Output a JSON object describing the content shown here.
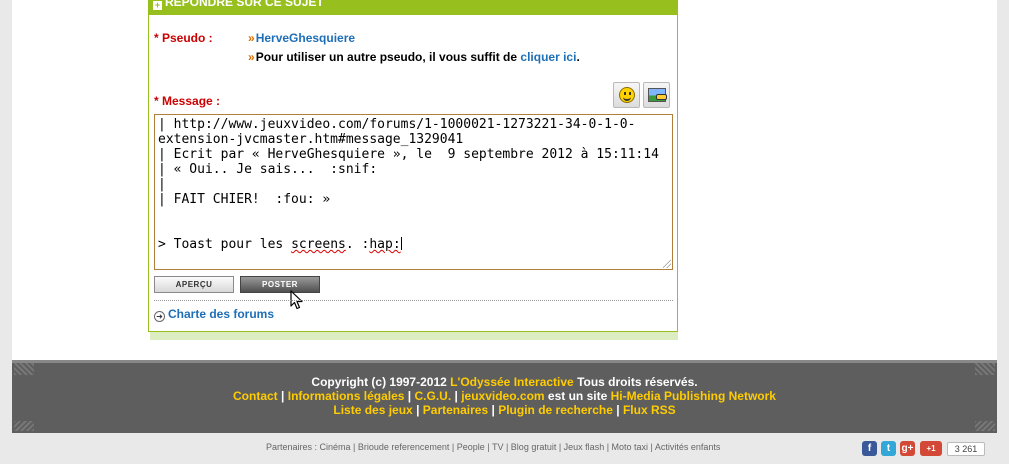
{
  "reply": {
    "header": "RÉPONDRE SUR CE SUJET",
    "plus_glyph": "+",
    "pseudo_label": "* Pseudo :",
    "chevron": "»",
    "pseudo_value": "HerveGhesquiere",
    "info_text": "Pour utiliser un autre pseudo, il vous suffit de",
    "info_link": "cliquer ici",
    "info_end": ".",
    "message_label": "* Message :",
    "message_lines": [
      "| http://www.jeuxvideo.com/forums/1-1000021-1273221-34-0-1-0-",
      "extension-jvcmaster.htm#message_1329041",
      "| Ecrit par « HerveGhesquiere », le  9 septembre 2012 à 15:11:14",
      "| « Oui.. Je sais...  :snif:",
      "|",
      "| FAIT CHIER!  :fou: »",
      "",
      ""
    ],
    "message_last_prefix": "> Toast pour les ",
    "message_last_word1": "screens",
    "message_last_mid": ". :",
    "message_last_word2": "hap:",
    "apercu_label": "APERÇU",
    "poster_label": "POSTER",
    "charte_arrow": "➜",
    "charte_label": "Charte des forums",
    "tools": [
      "smiley-icon",
      "image-icon"
    ]
  },
  "footer": {
    "copyright_prefix": "Copyright (c) 1997-2012",
    "company": "L'Odyssée Interactive",
    "rights": "Tous droits réservés.",
    "links_line2": [
      "Contact",
      "Informations légales",
      "C.G.U.",
      "jeuxvideo.com"
    ],
    "site_text": "est un site",
    "network": "Hi-Media Publishing Network",
    "links_line3": [
      "Liste des jeux",
      "Partenaires",
      "Plugin de recherche",
      "Flux RSS"
    ],
    "sep": "|"
  },
  "partners_text": "Partenaires : Cinéma | Brioude referencement | People | TV | Blog gratuit | Jeux flash | Moto taxi | Activités enfants",
  "social": {
    "facebook": "f",
    "twitter": "t",
    "googleplus": "g+",
    "plusone": "+1",
    "count": "3 261"
  },
  "colors": {
    "accent_green": "#97c01f",
    "label_red": "#cc0000",
    "link_blue": "#1e6fb5",
    "footer_yellow": "#ffcc00"
  }
}
